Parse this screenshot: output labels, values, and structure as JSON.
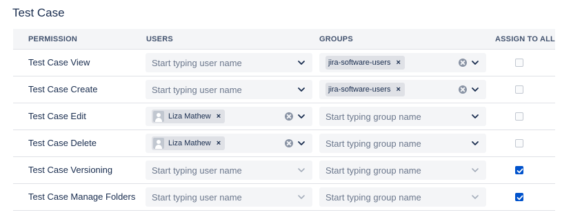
{
  "section": {
    "title": "Test Case"
  },
  "table": {
    "headers": {
      "permission": "PERMISSION",
      "users": "USERS",
      "groups": "GROUPS",
      "assign_to_all": "ASSIGN TO ALL"
    },
    "rows": [
      {
        "permission": "Test Case View",
        "users": {
          "placeholder": "Start typing user name",
          "selected": null
        },
        "groups": {
          "placeholder": "",
          "selected": "jira-software-users"
        },
        "assign_to_all": false
      },
      {
        "permission": "Test Case Create",
        "users": {
          "placeholder": "Start typing user name",
          "selected": null
        },
        "groups": {
          "placeholder": "",
          "selected": "jira-software-users"
        },
        "assign_to_all": false
      },
      {
        "permission": "Test Case Edit",
        "users": {
          "placeholder": "",
          "selected": "Liza Mathew"
        },
        "groups": {
          "placeholder": "Start typing group name",
          "selected": null
        },
        "assign_to_all": false
      },
      {
        "permission": "Test Case Delete",
        "users": {
          "placeholder": "",
          "selected": "Liza Mathew"
        },
        "groups": {
          "placeholder": "Start typing group name",
          "selected": null
        },
        "assign_to_all": false
      },
      {
        "permission": "Test Case Versioning",
        "users": {
          "placeholder": "Start typing user name",
          "selected": null
        },
        "groups": {
          "placeholder": "Start typing group name",
          "selected": null
        },
        "assign_to_all": true
      },
      {
        "permission": "Test Case Manage Folders",
        "users": {
          "placeholder": "Start typing user name",
          "selected": null
        },
        "groups": {
          "placeholder": "Start typing group name",
          "selected": null
        },
        "assign_to_all": true
      }
    ]
  },
  "colors": {
    "accent": "#0052cc",
    "header_bg": "#f4f5f7",
    "text": "#172b4d",
    "placeholder": "#6b778c"
  },
  "icons": {
    "chevron": "chevron-down-icon",
    "clear": "clear-icon",
    "remove_chip": "close-icon",
    "avatar": "user-avatar-icon",
    "check": "checkmark-icon"
  }
}
